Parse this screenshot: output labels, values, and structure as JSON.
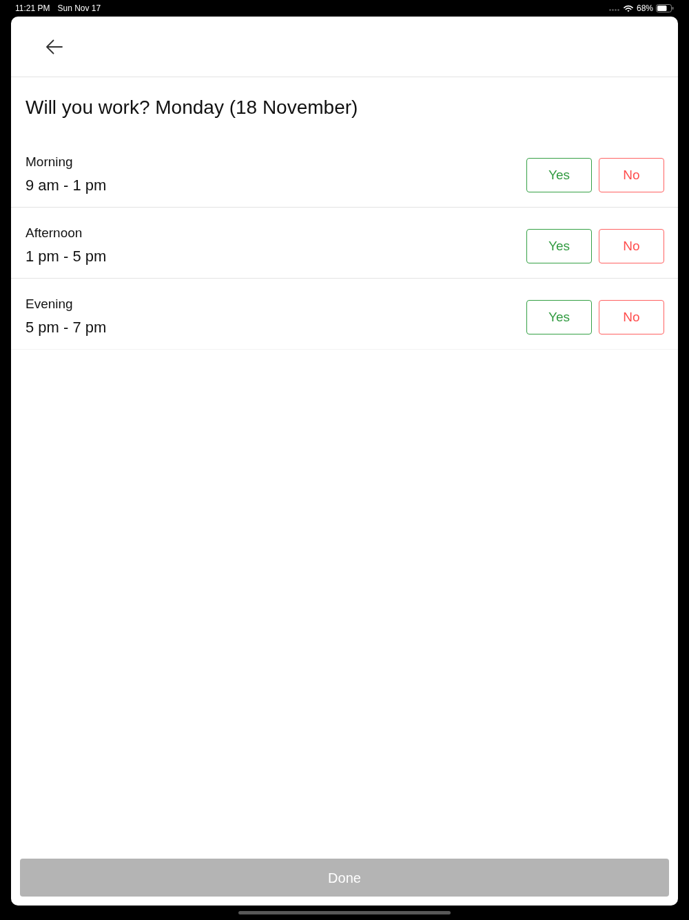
{
  "status_bar": {
    "time": "11:21 PM",
    "date": "Sun Nov 17",
    "battery": "68%"
  },
  "title": "Will you work? Monday (18 November)",
  "shifts": [
    {
      "name": "Morning",
      "hours": "9 am - 1 pm",
      "options": [
        {
          "label": "Yes",
          "kind": "yes",
          "selected": false
        },
        {
          "label": "No",
          "kind": "no",
          "selected": false
        }
      ]
    },
    {
      "name": "Afternoon",
      "hours": "1 pm - 5 pm",
      "options": [
        {
          "label": "Yes",
          "kind": "yes",
          "selected": false
        },
        {
          "label": "No",
          "kind": "no",
          "selected": false
        }
      ]
    },
    {
      "name": "Evening",
      "hours": "5 pm - 7 pm",
      "options": [
        {
          "label": "Yes",
          "kind": "yes",
          "selected": false
        },
        {
          "label": "No",
          "kind": "no",
          "selected": false
        }
      ]
    }
  ],
  "done_button": {
    "label": "Done",
    "disabled": true
  }
}
